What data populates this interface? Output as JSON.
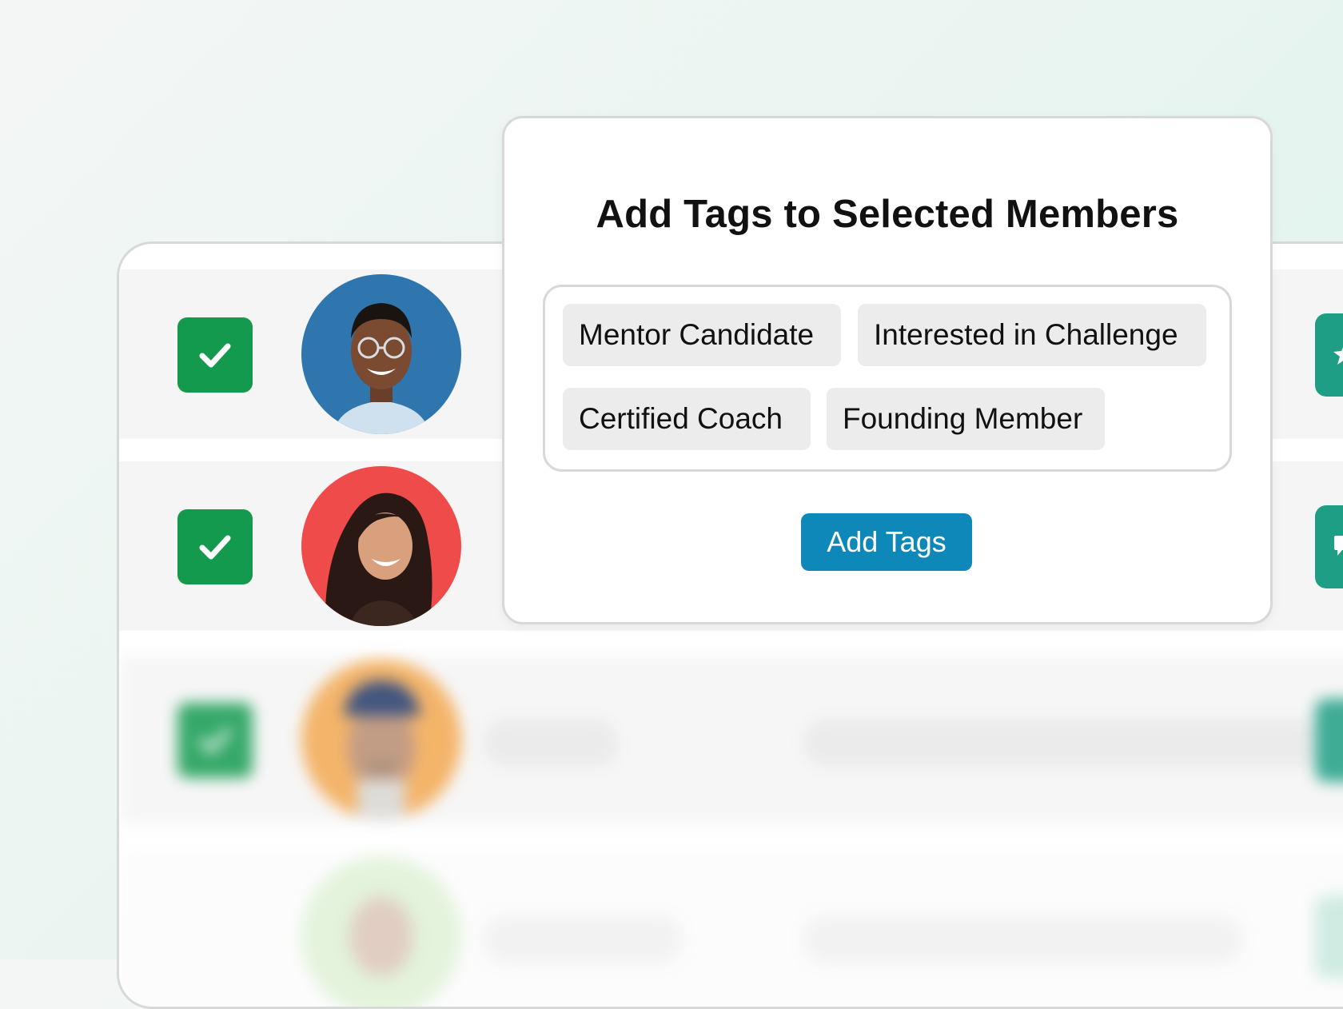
{
  "modal": {
    "title": "Add Tags to Selected Members",
    "tags": [
      {
        "label": "Mentor Candidate"
      },
      {
        "label": "Interested in Challenge"
      },
      {
        "label": "Certified Coach"
      },
      {
        "label": "Founding Member"
      }
    ],
    "add_button_label": "Add Tags"
  },
  "members": [
    {
      "selected": true,
      "avatar_bg": "#2e76ad",
      "avatar_icon": "man-with-glasses-photo"
    },
    {
      "selected": true,
      "avatar_bg": "#f04b4b",
      "avatar_icon": "smiling-woman-photo"
    },
    {
      "selected": true,
      "avatar_bg": "#f3a851",
      "avatar_icon": "man-with-cap-photo",
      "blurred": true
    },
    {
      "selected": true,
      "avatar_bg": "#cdeac0",
      "avatar_icon": "person-photo",
      "blurred": true
    }
  ],
  "colors": {
    "checkbox": "#139a4f",
    "action_button": "#1e9e84",
    "primary_button": "#0e87b9",
    "tag_bg": "#ececec"
  },
  "icons": {
    "checkbox": "checkmark-icon",
    "row1_action": "star-icon",
    "row2_action": "comment-icon"
  }
}
